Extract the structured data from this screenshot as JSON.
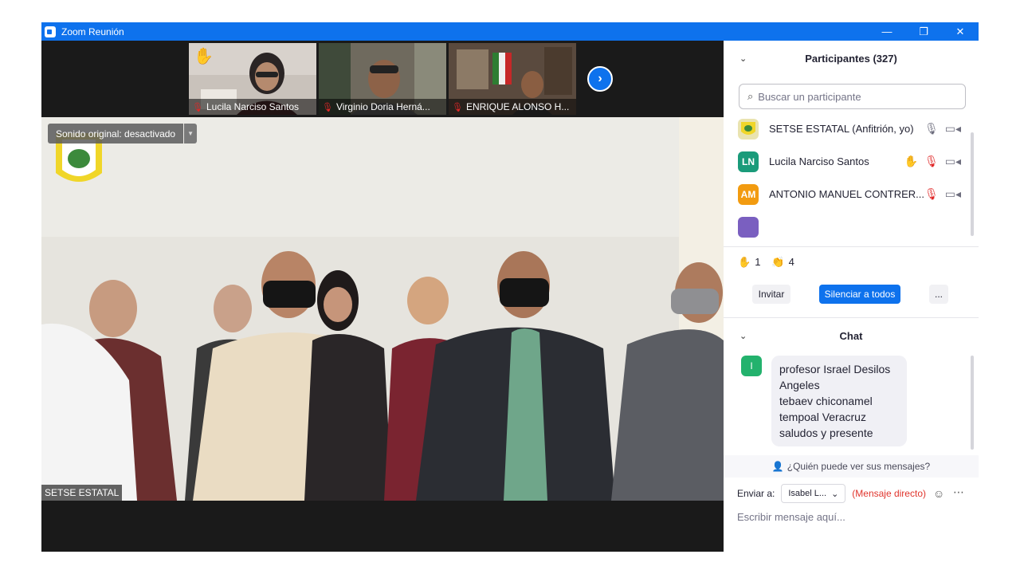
{
  "window": {
    "title": "Zoom Reunión",
    "minimize": "—",
    "restore": "❐",
    "close": "✕"
  },
  "thumbnails": [
    {
      "name": "Lucila Narciso Santos",
      "hand": "✋"
    },
    {
      "name": "Virginio Doria Herná..."
    },
    {
      "name": "ENRIQUE ALONSO H..."
    }
  ],
  "next_page": "›",
  "main_video": {
    "name": "SETSE ESTATAL",
    "original_sound": "Sonido original: desactivado"
  },
  "participants": {
    "title": "Participantes (327)",
    "search_placeholder": "Buscar un participante",
    "list": [
      {
        "initials": "",
        "name": "SETSE ESTATAL (Anfitrión, yo)",
        "color": "#e9e3b0"
      },
      {
        "initials": "LN",
        "name": "Lucila Narciso Santos",
        "color": "#1a9b7a"
      },
      {
        "initials": "AM",
        "name": "ANTONIO MANUEL CONTRER...",
        "color": "#f29b10"
      }
    ],
    "reactions": {
      "hand_count": "1",
      "clap_count": "4"
    },
    "invite": "Invitar",
    "mute_all": "Silenciar a todos",
    "more": "..."
  },
  "chat": {
    "title": "Chat",
    "message": {
      "initial": "I",
      "lines": [
        "profesor Israel Desilos Angeles",
        "tebaev chiconamel",
        "tempoal Veracruz",
        "saludos y presente"
      ]
    },
    "who_can_see": "¿Quién puede ver sus mensajes?",
    "send_to_label": "Enviar a:",
    "send_to_value": "Isabel L...",
    "direct": "(Mensaje directo)",
    "input_placeholder": "Escribir mensaje aquí..."
  },
  "colors": {
    "zoom_blue": "#0e72ed",
    "mic_off_red": "#e02828"
  }
}
